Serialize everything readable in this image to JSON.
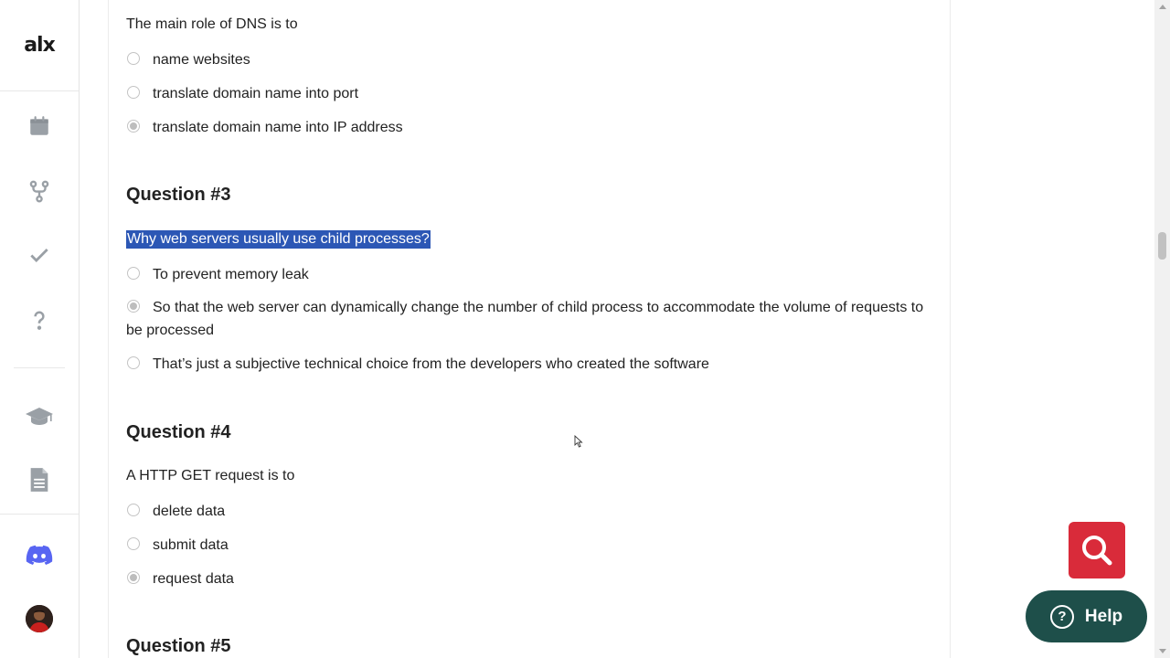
{
  "brand": {
    "logo_text": "alx"
  },
  "sidebar": {
    "icons": [
      "calendar-icon",
      "branch-icon",
      "check-icon",
      "question-icon",
      "graduation-cap-icon",
      "document-icon",
      "discord-icon"
    ]
  },
  "quiz": {
    "q2": {
      "prompt": "The main role of DNS is to",
      "options": [
        "name websites",
        "translate domain name into port",
        "translate domain name into IP address"
      ],
      "selected": 2
    },
    "q3": {
      "title": "Question #3",
      "prompt": "Why web servers usually use child processes?",
      "options": [
        "To prevent memory leak",
        "So that the web server can dynamically change the number of child process to accommodate the volume of requests to be processed",
        "That’s just a subjective technical choice from the developers who created the software"
      ],
      "selected": 1
    },
    "q4": {
      "title": "Question #4",
      "prompt": "A HTTP GET request is to",
      "options": [
        "delete data",
        "submit data",
        "request data"
      ],
      "selected": 2
    },
    "q5": {
      "title": "Question #5"
    }
  },
  "widgets": {
    "help_label": "Help",
    "search_color": "#d92b3a",
    "help_color": "#1e4f4a"
  }
}
